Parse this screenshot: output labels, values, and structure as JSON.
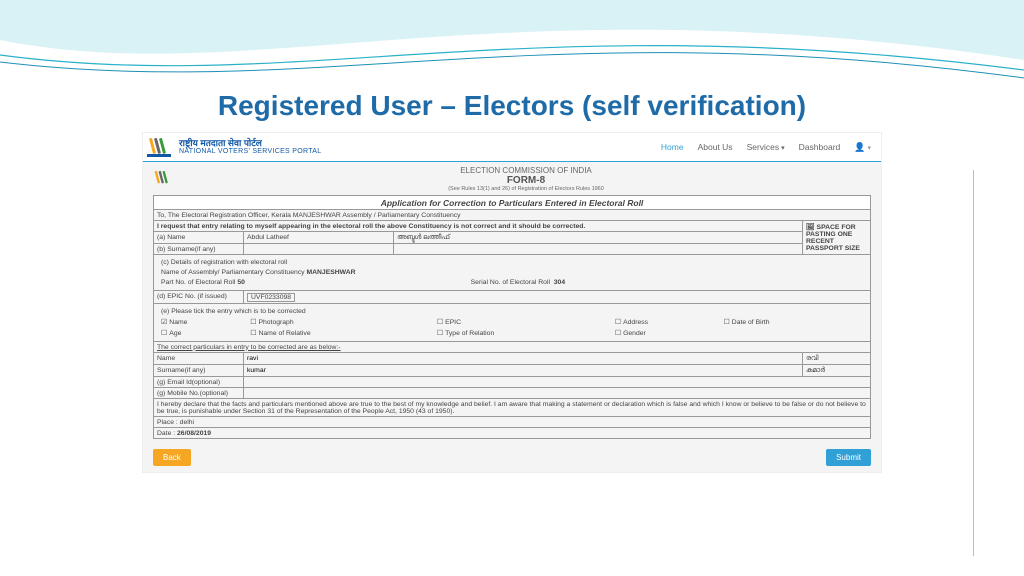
{
  "slide_title": "Registered User – Electors (self verification)",
  "portal": {
    "name_hindi": "राष्ट्रीय मतदाता सेवा पोर्टल",
    "name_english": "NATIONAL VOTERS' SERVICES PORTAL",
    "nav": {
      "home": "Home",
      "about": "About Us",
      "services": "Services",
      "dashboard": "Dashboard"
    }
  },
  "form_header": {
    "commission": "ELECTION COMMISSION OF INDIA",
    "form_no": "FORM-8",
    "rules_ref": "(See Rules 13(1) and 26) of Registration of Electors Rules 1960",
    "app_title": "Application for Correction to Particulars Entered in Electoral Roll"
  },
  "form": {
    "to_line": "To, The Electoral Registration Officer, Kerala MANJESHWAR Assembly / Parliamentary Constituency",
    "request_line": "I request that entry relating to myself appearing in the electoral roll the above Constituency is not correct and it should be corrected.",
    "photo_note": "SPACE FOR PASTING ONE RECENT PASSPORT SIZE",
    "name_label": "(a) Name",
    "name_value": "Abdul Latheef",
    "name_native": "അബ്ദുൾ ലത്തീഫ്",
    "surname_label": "(b) Surname(if any)",
    "details_c": "(c) Details of registration with electoral roll",
    "assembly_line": "Name of Assembly/ Parliamentary Constituency",
    "assembly_value": "MANJESHWAR",
    "part_label": "Part No. of Electoral Roll",
    "part_value": "50",
    "serial_label": "Serial No. of Electoral Roll",
    "serial_value": "304",
    "epic_label": "(d) EPIC No. (if issued)",
    "epic_value": "UVF0233098",
    "tick_line": "(e) Please tick the entry which is to be corrected",
    "opt_name": "Name",
    "opt_photo": "Photograph",
    "opt_epic": "EPIC",
    "opt_address": "Address",
    "opt_dob": "Date of Birth",
    "opt_age": "Age",
    "opt_relative": "Name of Relative",
    "opt_reltype": "Type of Relation",
    "opt_gender": "Gender",
    "correct_heading": "The correct particulars in entry to be corrected are as below:-",
    "corr_name_label": "Name",
    "corr_name_value": "ravi",
    "corr_name_native": "രവി",
    "corr_surname_label": "Surname(if any)",
    "corr_surname_value": "kumar",
    "corr_surname_native": "കുമാർ",
    "email_label": "(g) Email Id(optional)",
    "mobile_label": "(g) Mobile No.(optional)",
    "declaration": "I hereby declare that the facts and particulars mentioned above are true to the best of my knowledge and belief. I am aware that making a statement or declaration which is false and which I know or believe to be false or do not believe to be true, is punishable under Section 31 of the Representation of the People Act, 1950 (43 of 1950).",
    "place_label": "Place :",
    "place_value": "delhi",
    "date_label": "Date :",
    "date_value": "26/08/2019"
  },
  "buttons": {
    "back": "Back",
    "submit": "Submit"
  }
}
